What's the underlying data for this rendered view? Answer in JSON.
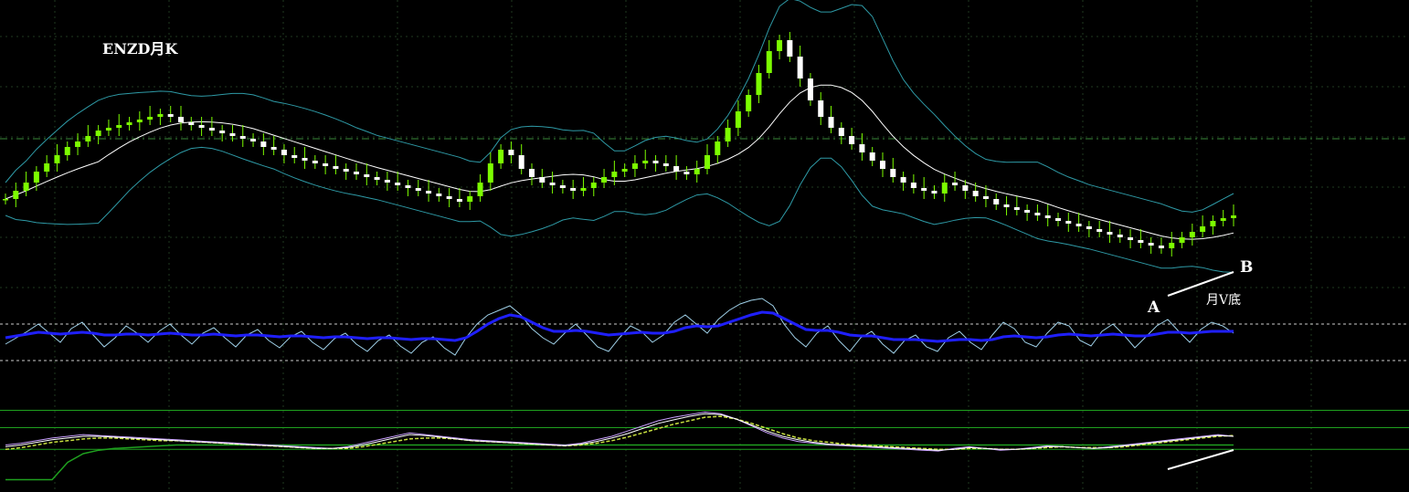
{
  "chart_data": {
    "type": "candlestick",
    "title": "ENZD月K",
    "annotations": {
      "point_a": "A",
      "point_b": "B",
      "pattern": "月V底"
    },
    "colors": {
      "background": "#000000",
      "grid": "#1f3a1f",
      "candle_up": "#7CFC00",
      "candle_down": "#ffffff",
      "wick": "#7CFC00",
      "mid_band": "#ffffff",
      "outer_band": "#2e9aa6",
      "reference_line": "#3a8a3a",
      "rsi_fast": "#9fd0e8",
      "rsi_slow": "#1f1fff",
      "stoch_k": "#c9a0ff",
      "stoch_d": "#ffffff",
      "stoch_slow": "#c8e040",
      "stoch_green": "#1fa01f",
      "level_lines": "#cccccc",
      "trend_line": "#ffffff"
    },
    "price_range": [
      0,
      100
    ],
    "reference_price": 56,
    "closes": [
      34,
      37,
      40,
      44,
      47,
      50,
      53,
      55,
      57,
      59,
      60,
      61,
      62,
      63,
      64,
      65,
      64,
      62,
      61,
      60,
      59,
      58,
      57,
      56,
      55,
      53,
      52,
      50,
      49,
      48,
      47,
      46,
      45,
      44,
      43,
      42,
      41,
      40,
      39,
      38,
      37,
      36,
      35,
      34,
      33,
      35,
      40,
      47,
      52,
      50,
      45,
      42,
      40,
      39,
      38,
      37,
      38,
      40,
      42,
      44,
      45,
      47,
      48,
      47,
      46,
      44,
      43,
      45,
      50,
      55,
      60,
      66,
      72,
      80,
      88,
      92,
      86,
      78,
      70,
      64,
      60,
      57,
      54,
      51,
      48,
      45,
      42,
      40,
      38,
      37,
      36,
      40,
      39,
      37,
      35,
      34,
      32,
      31,
      30,
      29,
      28,
      27,
      26,
      25,
      24,
      23,
      22,
      21,
      20,
      19,
      18,
      17,
      16,
      18,
      20,
      22,
      24,
      26,
      27,
      28
    ],
    "rsi_levels": [
      70,
      30
    ],
    "rsi_fast": [
      48,
      55,
      62,
      70,
      60,
      50,
      65,
      72,
      58,
      45,
      55,
      68,
      60,
      50,
      62,
      70,
      58,
      48,
      60,
      66,
      55,
      45,
      58,
      64,
      52,
      44,
      56,
      62,
      50,
      42,
      54,
      60,
      48,
      40,
      52,
      58,
      46,
      38,
      50,
      56,
      44,
      36,
      55,
      70,
      80,
      85,
      90,
      80,
      65,
      55,
      48,
      60,
      70,
      58,
      45,
      40,
      55,
      68,
      62,
      50,
      58,
      72,
      80,
      70,
      60,
      75,
      85,
      92,
      96,
      98,
      90,
      70,
      55,
      45,
      60,
      68,
      52,
      40,
      55,
      62,
      48,
      38,
      52,
      58,
      45,
      40,
      55,
      62,
      50,
      42,
      58,
      72,
      65,
      50,
      45,
      60,
      72,
      68,
      52,
      46,
      62,
      70,
      58,
      44,
      56,
      68,
      75,
      62,
      50,
      64,
      72,
      68,
      60
    ],
    "rsi_slow": [
      55,
      57,
      59,
      61,
      60,
      59,
      60,
      61,
      60,
      58,
      58,
      59,
      59,
      58,
      59,
      60,
      59,
      58,
      58,
      59,
      58,
      57,
      58,
      58,
      57,
      56,
      57,
      57,
      56,
      55,
      56,
      56,
      55,
      54,
      55,
      55,
      54,
      53,
      54,
      54,
      53,
      52,
      55,
      62,
      70,
      76,
      80,
      78,
      72,
      66,
      62,
      62,
      63,
      62,
      60,
      58,
      59,
      60,
      61,
      60,
      60,
      62,
      66,
      68,
      67,
      68,
      72,
      76,
      80,
      83,
      82,
      76,
      70,
      64,
      63,
      63,
      61,
      58,
      57,
      57,
      55,
      53,
      53,
      53,
      52,
      51,
      52,
      53,
      53,
      52,
      53,
      56,
      57,
      56,
      55,
      56,
      58,
      59,
      58,
      57,
      58,
      59,
      58,
      57,
      57,
      59,
      61,
      61,
      60,
      61,
      62,
      62,
      62
    ],
    "stoch_levels": [
      90,
      70,
      45
    ],
    "stoch_k": [
      50,
      52,
      55,
      58,
      60,
      62,
      61,
      60,
      59,
      58,
      57,
      56,
      55,
      54,
      53,
      52,
      51,
      50,
      49,
      48,
      47,
      46,
      48,
      52,
      56,
      60,
      64,
      62,
      60,
      58,
      56,
      55,
      54,
      53,
      52,
      51,
      50,
      52,
      56,
      60,
      66,
      72,
      78,
      82,
      85,
      88,
      86,
      80,
      72,
      64,
      58,
      54,
      52,
      50,
      49,
      48,
      47,
      46,
      45,
      44,
      43,
      46,
      48,
      46,
      44,
      45,
      47,
      49,
      48,
      47,
      46,
      48,
      50,
      52,
      54,
      56,
      58,
      60,
      62,
      60
    ],
    "stoch_d": [
      48,
      50,
      53,
      56,
      58,
      60,
      60,
      59,
      58,
      57,
      56,
      55,
      54,
      53,
      52,
      51,
      50,
      49,
      48,
      47,
      46,
      46,
      47,
      50,
      54,
      58,
      62,
      61,
      59,
      57,
      55,
      54,
      53,
      52,
      51,
      50,
      49,
      51,
      54,
      58,
      63,
      69,
      75,
      79,
      83,
      86,
      85,
      80,
      73,
      66,
      60,
      56,
      53,
      51,
      50,
      49,
      48,
      47,
      46,
      45,
      44,
      45,
      47,
      46,
      45,
      45,
      46,
      48,
      48,
      47,
      46,
      47,
      49,
      51,
      53,
      55,
      57,
      59,
      61,
      60
    ],
    "stoch_slow": [
      45,
      47,
      50,
      53,
      55,
      57,
      58,
      58,
      57,
      56,
      55,
      55,
      54,
      53,
      52,
      51,
      50,
      49,
      48,
      47,
      46,
      46,
      46,
      48,
      51,
      54,
      57,
      58,
      58,
      57,
      55,
      54,
      53,
      52,
      51,
      50,
      49,
      50,
      52,
      55,
      59,
      64,
      69,
      74,
      78,
      82,
      83,
      80,
      75,
      69,
      63,
      58,
      55,
      53,
      51,
      50,
      49,
      48,
      47,
      46,
      45,
      45,
      46,
      46,
      45,
      45,
      46,
      47,
      48,
      47,
      47,
      47,
      48,
      50,
      52,
      54,
      56,
      58,
      60,
      61
    ],
    "stoch_green": [
      10,
      10,
      10,
      10,
      30,
      40,
      44,
      46,
      47,
      48,
      49,
      50,
      50,
      50,
      50,
      50,
      50,
      50,
      50,
      50,
      50,
      50,
      50,
      50,
      50,
      50,
      50,
      50,
      50,
      50,
      50,
      50,
      50,
      50,
      50,
      50,
      50,
      50,
      50,
      50,
      50,
      50,
      50,
      50,
      50,
      50,
      50,
      50,
      50,
      50,
      50,
      50,
      50,
      50,
      50,
      50,
      50,
      50,
      50,
      50,
      50,
      50,
      50,
      50,
      50,
      50,
      50,
      50,
      50,
      50,
      50,
      50,
      50,
      50,
      50,
      50,
      50,
      50,
      50,
      50
    ]
  }
}
